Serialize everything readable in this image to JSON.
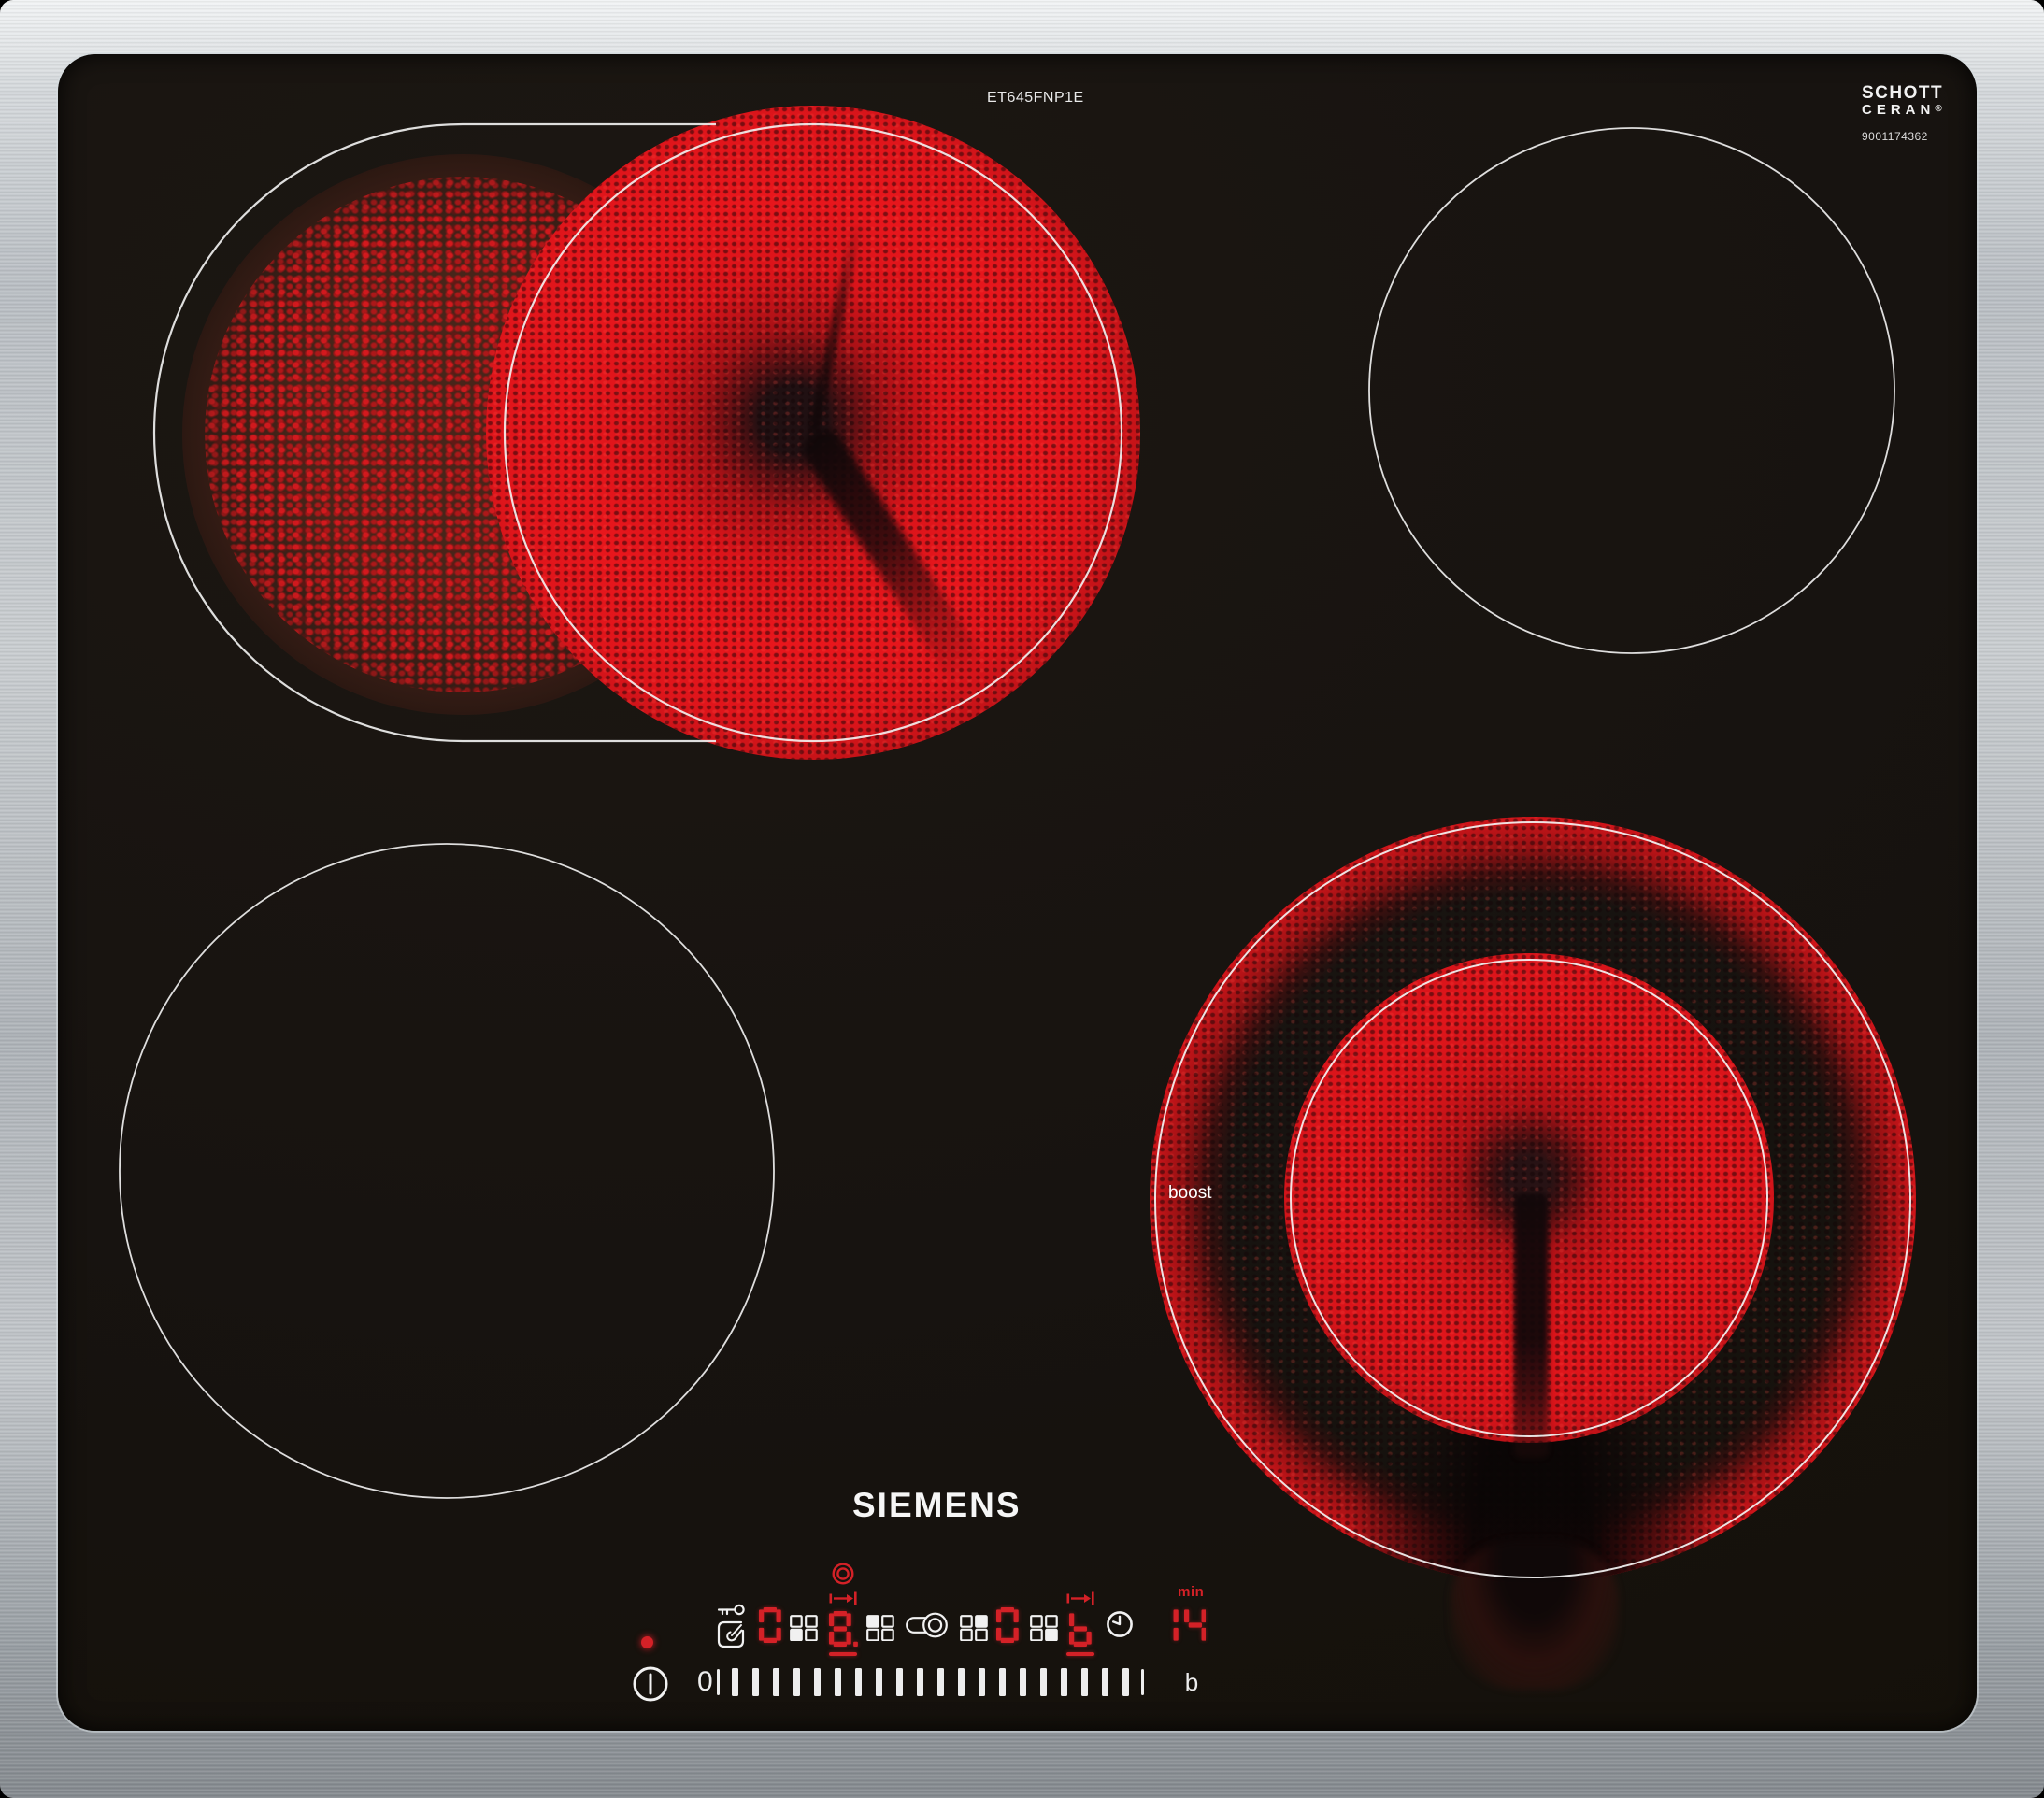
{
  "branding": {
    "model_number": "ET645FNP1E",
    "brand_logo": "SIEMENS",
    "glass_brand": {
      "line1": "SCHOTT",
      "line2": "CERAN",
      "registered": "®",
      "code": "9001174362"
    }
  },
  "zones": {
    "rear_left": {
      "name": "rear-left dual roaster zone",
      "state": "heating",
      "level_shown": "8"
    },
    "rear_right": {
      "name": "rear-right zone",
      "state": "off",
      "level_shown": "0"
    },
    "front_left": {
      "name": "front-left zone",
      "state": "off",
      "level_shown": "0"
    },
    "front_right": {
      "name": "front-right dual-ring zone",
      "state": "boost",
      "label": "boost",
      "level_shown": "b"
    }
  },
  "control_panel": {
    "power_indicator_on": true,
    "power_button_symbol": "power-circle-with-line",
    "child_lock_icon": "key-over-touch-hand",
    "dual_zone_key_icon": "pill-with-double-circle",
    "zone_displays": [
      {
        "zone": "front-left",
        "value": "0",
        "decimal": false,
        "grid_filled": "bl",
        "grid_side": "right",
        "selected": false,
        "extension": false,
        "dual_ring_indicator": false
      },
      {
        "zone": "rear-left",
        "value": "8",
        "decimal": true,
        "grid_filled": "tl",
        "grid_side": "right",
        "selected": true,
        "extension": true,
        "dual_ring_indicator": true
      },
      {
        "zone": "rear-right",
        "value": "0",
        "decimal": false,
        "grid_filled": "tr",
        "grid_side": "left",
        "selected": false,
        "extension": false,
        "dual_ring_indicator": false
      },
      {
        "zone": "front-right",
        "value": "b",
        "decimal": false,
        "grid_filled": "br",
        "grid_side": "left",
        "selected": true,
        "extension": true,
        "dual_ring_indicator": false
      }
    ],
    "timer": {
      "icon": "clock",
      "value": "14",
      "unit": "min"
    },
    "slider": {
      "start_label": "0",
      "end_label": "b",
      "major_ticks": 20
    }
  },
  "colors": {
    "led_red": "#d42127",
    "glow_red": "#e8161c",
    "steel": "#b9bec3",
    "glass_black": "#171310",
    "outline_white": "#f4f4f4"
  }
}
